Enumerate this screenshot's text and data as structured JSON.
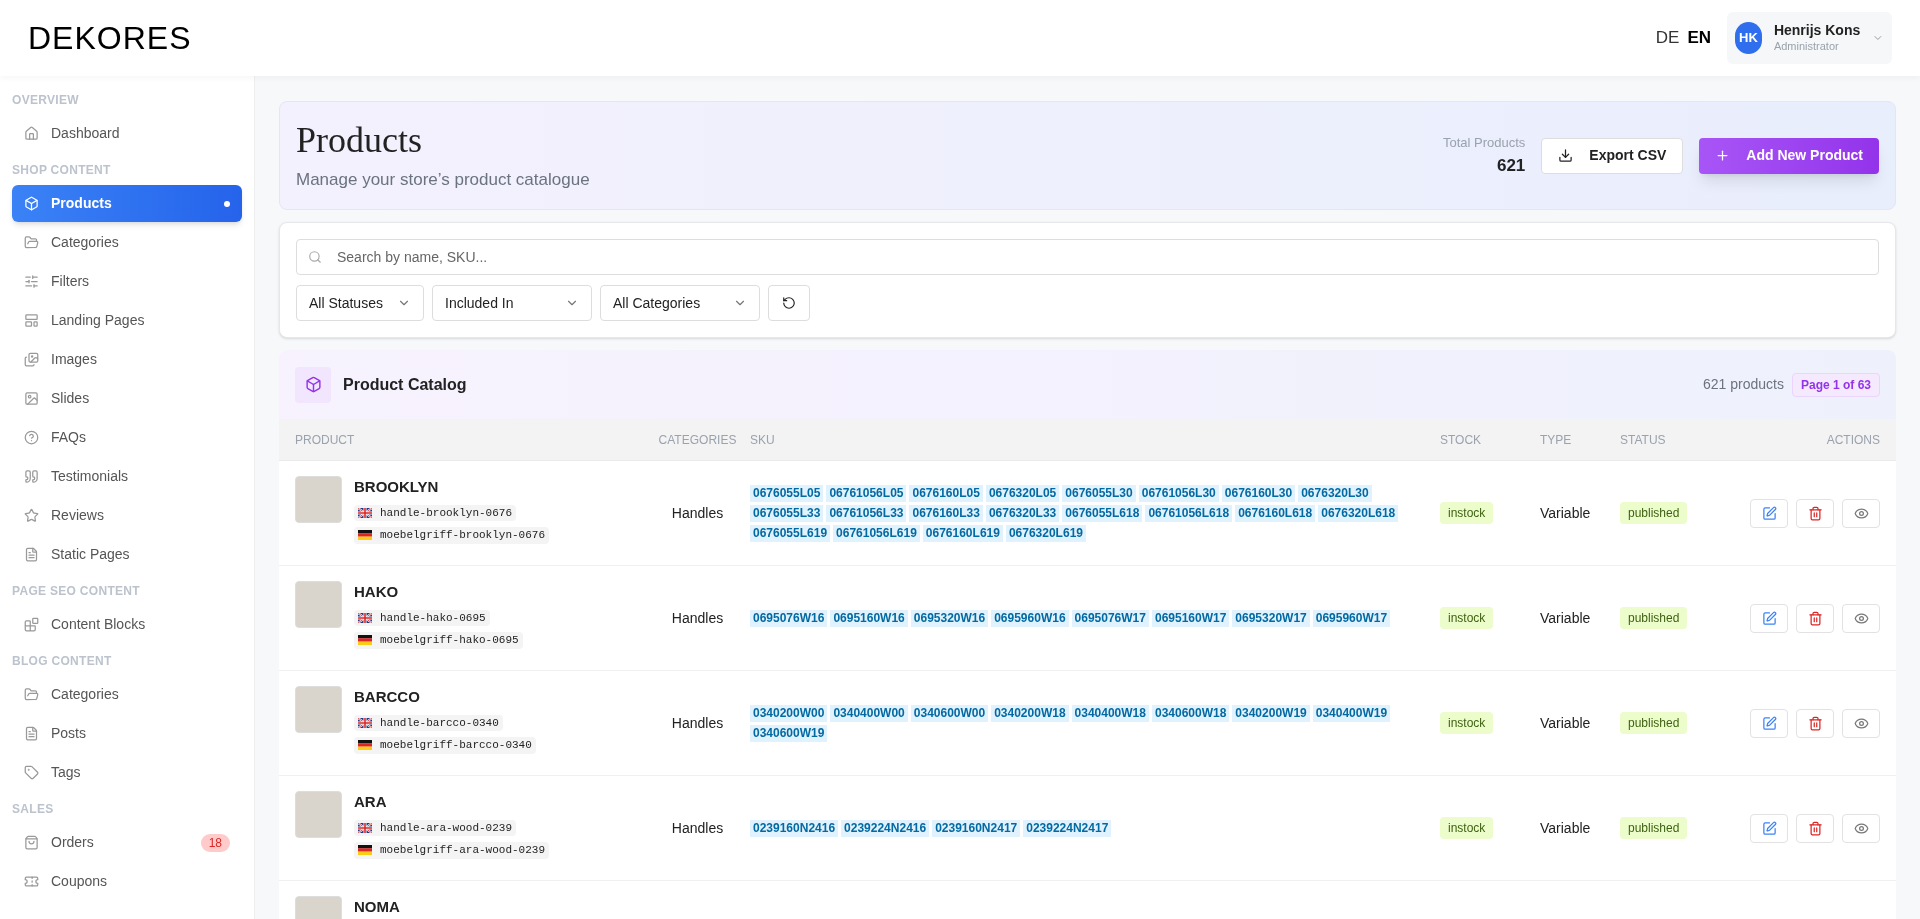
{
  "logo": "DEKORES",
  "languages": [
    {
      "label": "DE",
      "selected": false
    },
    {
      "label": "EN",
      "selected": true
    }
  ],
  "user": {
    "initials": "HK",
    "name": "Henrijs Kons",
    "role": "Administrator"
  },
  "sidebar": {
    "sections": [
      {
        "title": "OVERVIEW",
        "items": [
          {
            "label": "Dashboard",
            "selected": false
          }
        ]
      },
      {
        "title": "SHOP CONTENT",
        "items": [
          {
            "label": "Products",
            "selected": true
          },
          {
            "label": "Categories",
            "selected": false
          },
          {
            "label": "Filters",
            "selected": false
          },
          {
            "label": "Landing Pages",
            "selected": false
          },
          {
            "label": "Images",
            "selected": false
          },
          {
            "label": "Slides",
            "selected": false
          },
          {
            "label": "FAQs",
            "selected": false
          },
          {
            "label": "Testimonials",
            "selected": false
          },
          {
            "label": "Reviews",
            "selected": false
          },
          {
            "label": "Static Pages",
            "selected": false
          }
        ]
      },
      {
        "title": "PAGE SEO CONTENT",
        "items": [
          {
            "label": "Content Blocks",
            "selected": false
          }
        ]
      },
      {
        "title": "BLOG CONTENT",
        "items": [
          {
            "label": "Categories",
            "selected": false
          },
          {
            "label": "Posts",
            "selected": false
          },
          {
            "label": "Tags",
            "selected": false
          }
        ]
      },
      {
        "title": "SALES",
        "items": [
          {
            "label": "Orders",
            "selected": false,
            "badge": "18"
          },
          {
            "label": "Coupons",
            "selected": false
          }
        ]
      }
    ]
  },
  "page": {
    "title": "Products",
    "subtitle": "Manage your store’s product catalogue",
    "total_label": "Total Products",
    "total": "621",
    "export_button": "Export CSV",
    "add_button": "Add New Product"
  },
  "filters": {
    "search_placeholder": "Search by name, SKU...",
    "selects": [
      "All Statuses",
      "Included In",
      "All Categories"
    ]
  },
  "catalog": {
    "title": "Product Catalog",
    "count": "621 products",
    "page": "Page 1 of 63",
    "columns": [
      "PRODUCT",
      "CATEGORIES",
      "SKU",
      "STOCK",
      "TYPE",
      "STATUS",
      "ACTIONS"
    ],
    "rows": [
      {
        "name": "BROOKLYN",
        "slug_en": "handle-brooklyn-0676",
        "slug_de": "moebelgriff-brooklyn-0676",
        "category": "Handles",
        "skus": [
          "0676055L05",
          "06761056L05",
          "0676160L05",
          "0676320L05",
          "0676055L30",
          "06761056L30",
          "0676160L30",
          "0676320L30",
          "0676055L33",
          "06761056L33",
          "0676160L33",
          "0676320L33",
          "0676055L618",
          "06761056L618",
          "0676160L618",
          "0676320L618",
          "0676055L619",
          "06761056L619",
          "0676160L619",
          "0676320L619"
        ],
        "stock": "instock",
        "type": "Variable",
        "status": "published"
      },
      {
        "name": "HAKO",
        "slug_en": "handle-hako-0695",
        "slug_de": "moebelgriff-hako-0695",
        "category": "Handles",
        "skus": [
          "0695076W16",
          "0695160W16",
          "0695320W16",
          "0695960W16",
          "0695076W17",
          "0695160W17",
          "0695320W17",
          "0695960W17"
        ],
        "stock": "instock",
        "type": "Variable",
        "status": "published"
      },
      {
        "name": "BARCCO",
        "slug_en": "handle-barcco-0340",
        "slug_de": "moebelgriff-barcco-0340",
        "category": "Handles",
        "skus": [
          "0340200W00",
          "0340400W00",
          "0340600W00",
          "0340200W18",
          "0340400W18",
          "0340600W18",
          "0340200W19",
          "0340400W19",
          "0340600W19"
        ],
        "stock": "instock",
        "type": "Variable",
        "status": "published"
      },
      {
        "name": "ARA",
        "slug_en": "handle-ara-wood-0239",
        "slug_de": "moebelgriff-ara-wood-0239",
        "category": "Handles",
        "skus": [
          "0239160N2416",
          "0239224N2416",
          "0239160N2417",
          "0239224N2417"
        ],
        "stock": "instock",
        "type": "Variable",
        "status": "published"
      },
      {
        "name": "NOMA"
      }
    ]
  }
}
